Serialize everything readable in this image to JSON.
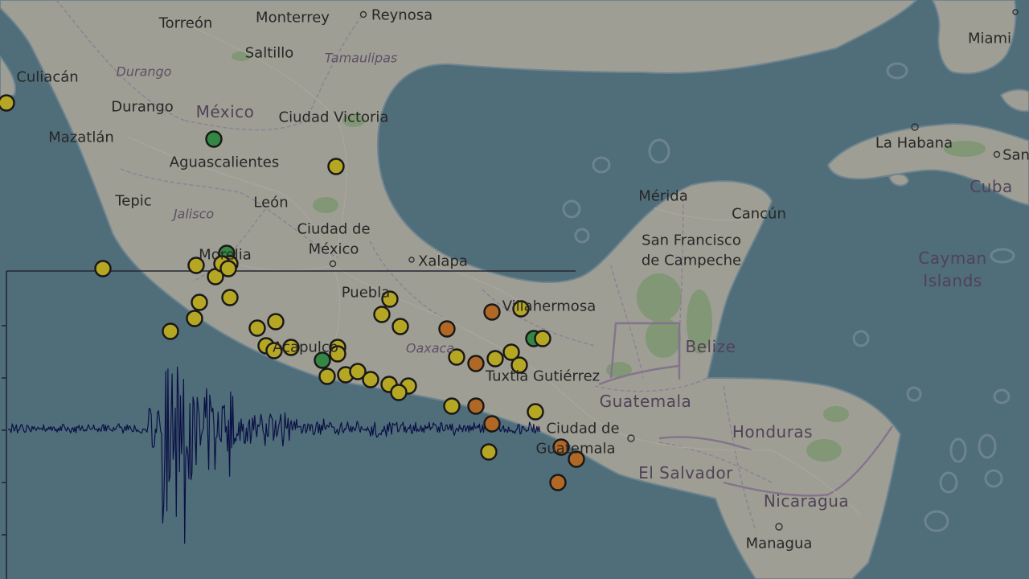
{
  "colors": {
    "sea": "#5e7f8e",
    "land": "#b9b9ad",
    "magnitude_green": "#3d9c4f",
    "magnitude_yellow": "#d3c22a",
    "magnitude_orange": "#cf7a2d",
    "seismogram": "#0d1450"
  },
  "labels": {
    "cities": [
      {
        "id": "torreon",
        "text": "Torreón"
      },
      {
        "id": "monterrey",
        "text": "Monterrey"
      },
      {
        "id": "reynosa",
        "text": "Reynosa"
      },
      {
        "id": "saltillo",
        "text": "Saltillo"
      },
      {
        "id": "culiacan",
        "text": "Culiacán"
      },
      {
        "id": "durango-city",
        "text": "Durango"
      },
      {
        "id": "ciudad-victoria",
        "text": "Ciudad Victoria"
      },
      {
        "id": "mazatlan",
        "text": "Mazatlán"
      },
      {
        "id": "aguascalientes",
        "text": "Aguascalientes"
      },
      {
        "id": "tepic",
        "text": "Tepic"
      },
      {
        "id": "leon",
        "text": "León"
      },
      {
        "id": "cdmx-line1",
        "text": "Ciudad de"
      },
      {
        "id": "cdmx-line2",
        "text": "México"
      },
      {
        "id": "morelia",
        "text": "Morelia"
      },
      {
        "id": "xalapa",
        "text": "Xalapa"
      },
      {
        "id": "puebla",
        "text": "Puebla"
      },
      {
        "id": "acapulco",
        "text": "Acapulco"
      },
      {
        "id": "villahermosa",
        "text": "Villahermosa"
      },
      {
        "id": "tuxtla",
        "text": "Tuxtla Gutiérrez"
      },
      {
        "id": "merida",
        "text": "Mérida"
      },
      {
        "id": "cancun",
        "text": "Cancún"
      },
      {
        "id": "campeche-line1",
        "text": "San Francisco"
      },
      {
        "id": "campeche-line2",
        "text": "de Campeche"
      },
      {
        "id": "guatemala-city-line1",
        "text": "Ciudad de"
      },
      {
        "id": "guatemala-city-line2",
        "text": "Guatemala"
      },
      {
        "id": "managua",
        "text": "Managua"
      },
      {
        "id": "la-habana",
        "text": "La Habana"
      },
      {
        "id": "miami",
        "text": "Miami"
      },
      {
        "id": "san-cut",
        "text": "San"
      }
    ],
    "countries": [
      {
        "id": "mexico",
        "text": "México"
      },
      {
        "id": "belize",
        "text": "Belize"
      },
      {
        "id": "guatemala",
        "text": "Guatemala"
      },
      {
        "id": "honduras",
        "text": "Honduras"
      },
      {
        "id": "el-salvador",
        "text": "El Salvador"
      },
      {
        "id": "nicaragua",
        "text": "Nicaragua"
      },
      {
        "id": "cuba",
        "text": "Cuba"
      },
      {
        "id": "cayman-line1",
        "text": "Cayman"
      },
      {
        "id": "cayman-line2",
        "text": "Islands"
      }
    ],
    "states": [
      {
        "id": "tamaulipas",
        "text": "Tamaulipas"
      },
      {
        "id": "durango-state",
        "text": "Durango"
      },
      {
        "id": "jalisco",
        "text": "Jalisco"
      },
      {
        "id": "oaxaca",
        "text": "Oaxaca"
      }
    ]
  },
  "markers": [
    {
      "c": "yellow"
    },
    {
      "c": "green"
    },
    {
      "c": "yellow"
    },
    {
      "c": "yellow"
    },
    {
      "c": "yellow"
    },
    {
      "c": "green"
    },
    {
      "c": "yellow"
    },
    {
      "c": "yellow"
    },
    {
      "c": "yellow"
    },
    {
      "c": "yellow"
    },
    {
      "c": "yellow"
    },
    {
      "c": "yellow"
    },
    {
      "c": "yellow"
    },
    {
      "c": "yellow"
    },
    {
      "c": "yellow"
    },
    {
      "c": "yellow"
    },
    {
      "c": "yellow"
    },
    {
      "c": "yellow"
    },
    {
      "c": "green"
    },
    {
      "c": "yellow"
    },
    {
      "c": "yellow"
    },
    {
      "c": "yellow"
    },
    {
      "c": "yellow"
    },
    {
      "c": "yellow"
    },
    {
      "c": "yellow"
    },
    {
      "c": "yellow"
    },
    {
      "c": "yellow"
    },
    {
      "c": "yellow"
    },
    {
      "c": "yellow"
    },
    {
      "c": "yellow"
    },
    {
      "c": "orange"
    },
    {
      "c": "yellow"
    },
    {
      "c": "orange"
    },
    {
      "c": "yellow"
    },
    {
      "c": "orange"
    },
    {
      "c": "yellow"
    },
    {
      "c": "yellow"
    },
    {
      "c": "yellow"
    },
    {
      "c": "green"
    },
    {
      "c": "yellow"
    },
    {
      "c": "yellow"
    },
    {
      "c": "orange"
    },
    {
      "c": "orange"
    },
    {
      "c": "yellow"
    },
    {
      "c": "yellow"
    },
    {
      "c": "orange"
    },
    {
      "c": "orange"
    },
    {
      "c": "orange"
    }
  ]
}
